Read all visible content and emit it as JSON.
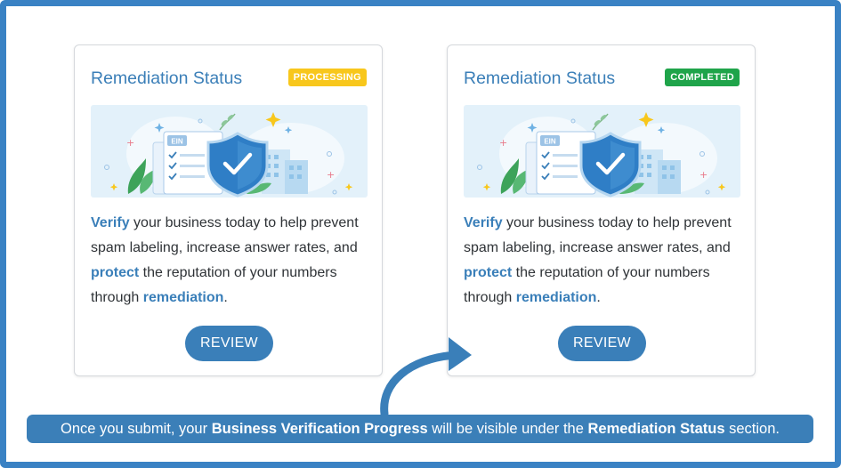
{
  "cards": [
    {
      "title": "Remediation Status",
      "badge": "PROCESSING",
      "text": {
        "verify": "Verify",
        "part1": " your business today to help prevent spam labeling, increase answer rates, and ",
        "protect": "protect",
        "part2": " the reputation of your numbers through ",
        "remediation": "remediation",
        "part3": "."
      },
      "illustration_label": "EIN",
      "button": "REVIEW"
    },
    {
      "title": "Remediation Status",
      "badge": "COMPLETED",
      "text": {
        "verify": "Verify",
        "part1": " your business today to help prevent spam labeling, increase answer rates, and ",
        "protect": "protect",
        "part2": " the reputation of your numbers through ",
        "remediation": "remediation",
        "part3": "."
      },
      "illustration_label": "EIN",
      "button": "REVIEW"
    }
  ],
  "caption": {
    "part1": "Once you submit, your ",
    "bold1": "Business Verification Progress",
    "part2": " will be visible under the ",
    "bold2": "Remediation Status",
    "part3": " section."
  },
  "colors": {
    "frame": "#3a82c4",
    "accent": "#3a7fb9",
    "processing": "#f8c71c",
    "completed": "#1fa44a"
  },
  "icons": [
    "shield-check-icon",
    "document-checklist-icon",
    "building-icon",
    "sparkle-icon",
    "curved-arrow-icon"
  ]
}
